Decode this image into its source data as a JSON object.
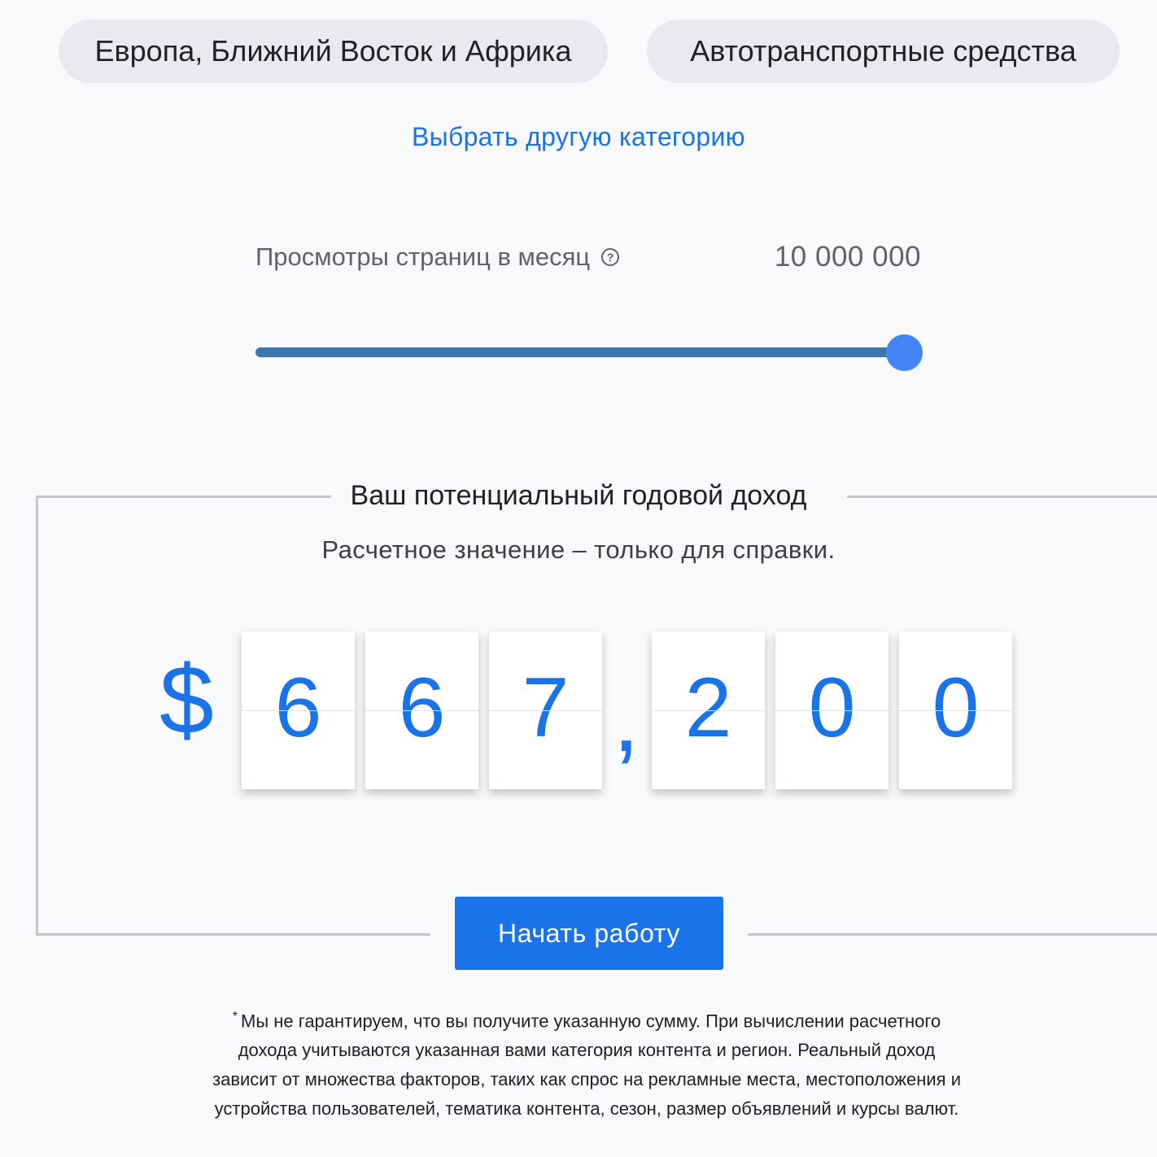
{
  "chips": {
    "region": "Европа, Ближний Восток и Африка",
    "category": "Автотранспортные средства"
  },
  "change_category_link": "Выбрать другую категорию",
  "pageviews": {
    "label": "Просмотры страниц в месяц",
    "help_icon": "?",
    "value": "10 000 000",
    "slider_fraction": 1.0
  },
  "income": {
    "title": "Ваш потенциальный годовой доход",
    "subtitle": "Расчетное значение – только для справки.",
    "currency": "$",
    "separator": ",",
    "digits": [
      "6",
      "6",
      "7",
      "2",
      "0",
      "0"
    ]
  },
  "start_button": "Начать работу",
  "disclaimer": {
    "asterisk": "*",
    "text": "Мы не гарантируем, что вы получите указанную сумму. При вычислении расчетного дохода учитываются указанная вами категория контента и регион. Реальный доход зависит от множества факторов, таких как спрос на рекламные места, местоположения и устройства пользователей, тематика контента, сезон, размер объявлений и курсы валют."
  },
  "colors": {
    "accent": "#1a73e8",
    "slider_track": "#3b76b0",
    "slider_thumb": "#4285f4",
    "chip_bg": "#e8eaed",
    "page_bg": "#f8f9fa"
  }
}
